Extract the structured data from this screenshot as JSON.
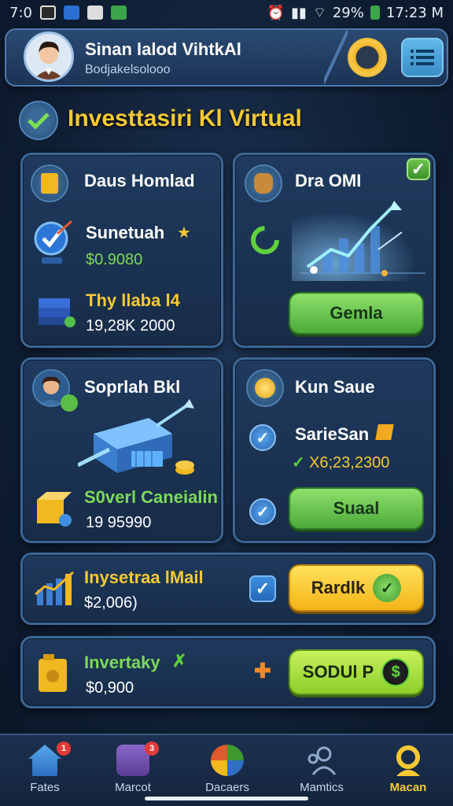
{
  "status_bar": {
    "left_text": "7:0",
    "battery": "29%",
    "time": "17:23 M"
  },
  "header": {
    "title": "Sinan lalod VihtkAl",
    "subtitle": "Bodjakelsolooo"
  },
  "section": {
    "title": "Investtasiri Kl Virtual"
  },
  "cards": {
    "card1": {
      "title": "Daus Homlad",
      "row1_label": "Sunetuah",
      "row1_value": "$0.9080",
      "row2_label": "Thy llaba l4",
      "row2_value": "19,28K 2000"
    },
    "card2": {
      "title": "Dra OMI",
      "button": "Gemla"
    },
    "card3": {
      "title": "Soprlah Bkl",
      "label": "S0verl Caneialin",
      "value": "19 95990"
    },
    "card4": {
      "title": "Kun Saue",
      "label": "SarieSan",
      "value": "X6;23,2300",
      "button": "Suaal"
    },
    "card5": {
      "label": "Inysetraa lMail",
      "value": "$2,006)",
      "button": "Rardlk"
    },
    "card6": {
      "label": "Invertaky",
      "value": "$0,900",
      "button": "SODUl P"
    }
  },
  "nav": {
    "items": [
      {
        "label": "Fates",
        "badge": "1"
      },
      {
        "label": "Marcot",
        "badge": "3"
      },
      {
        "label": "Dacaers",
        "badge": ""
      },
      {
        "label": "Mamtics",
        "badge": ""
      },
      {
        "label": "Macan",
        "badge": ""
      }
    ]
  },
  "colors": {
    "accent_gold": "#f6c934",
    "accent_green": "#66cc44",
    "card_border": "#3c6696"
  }
}
